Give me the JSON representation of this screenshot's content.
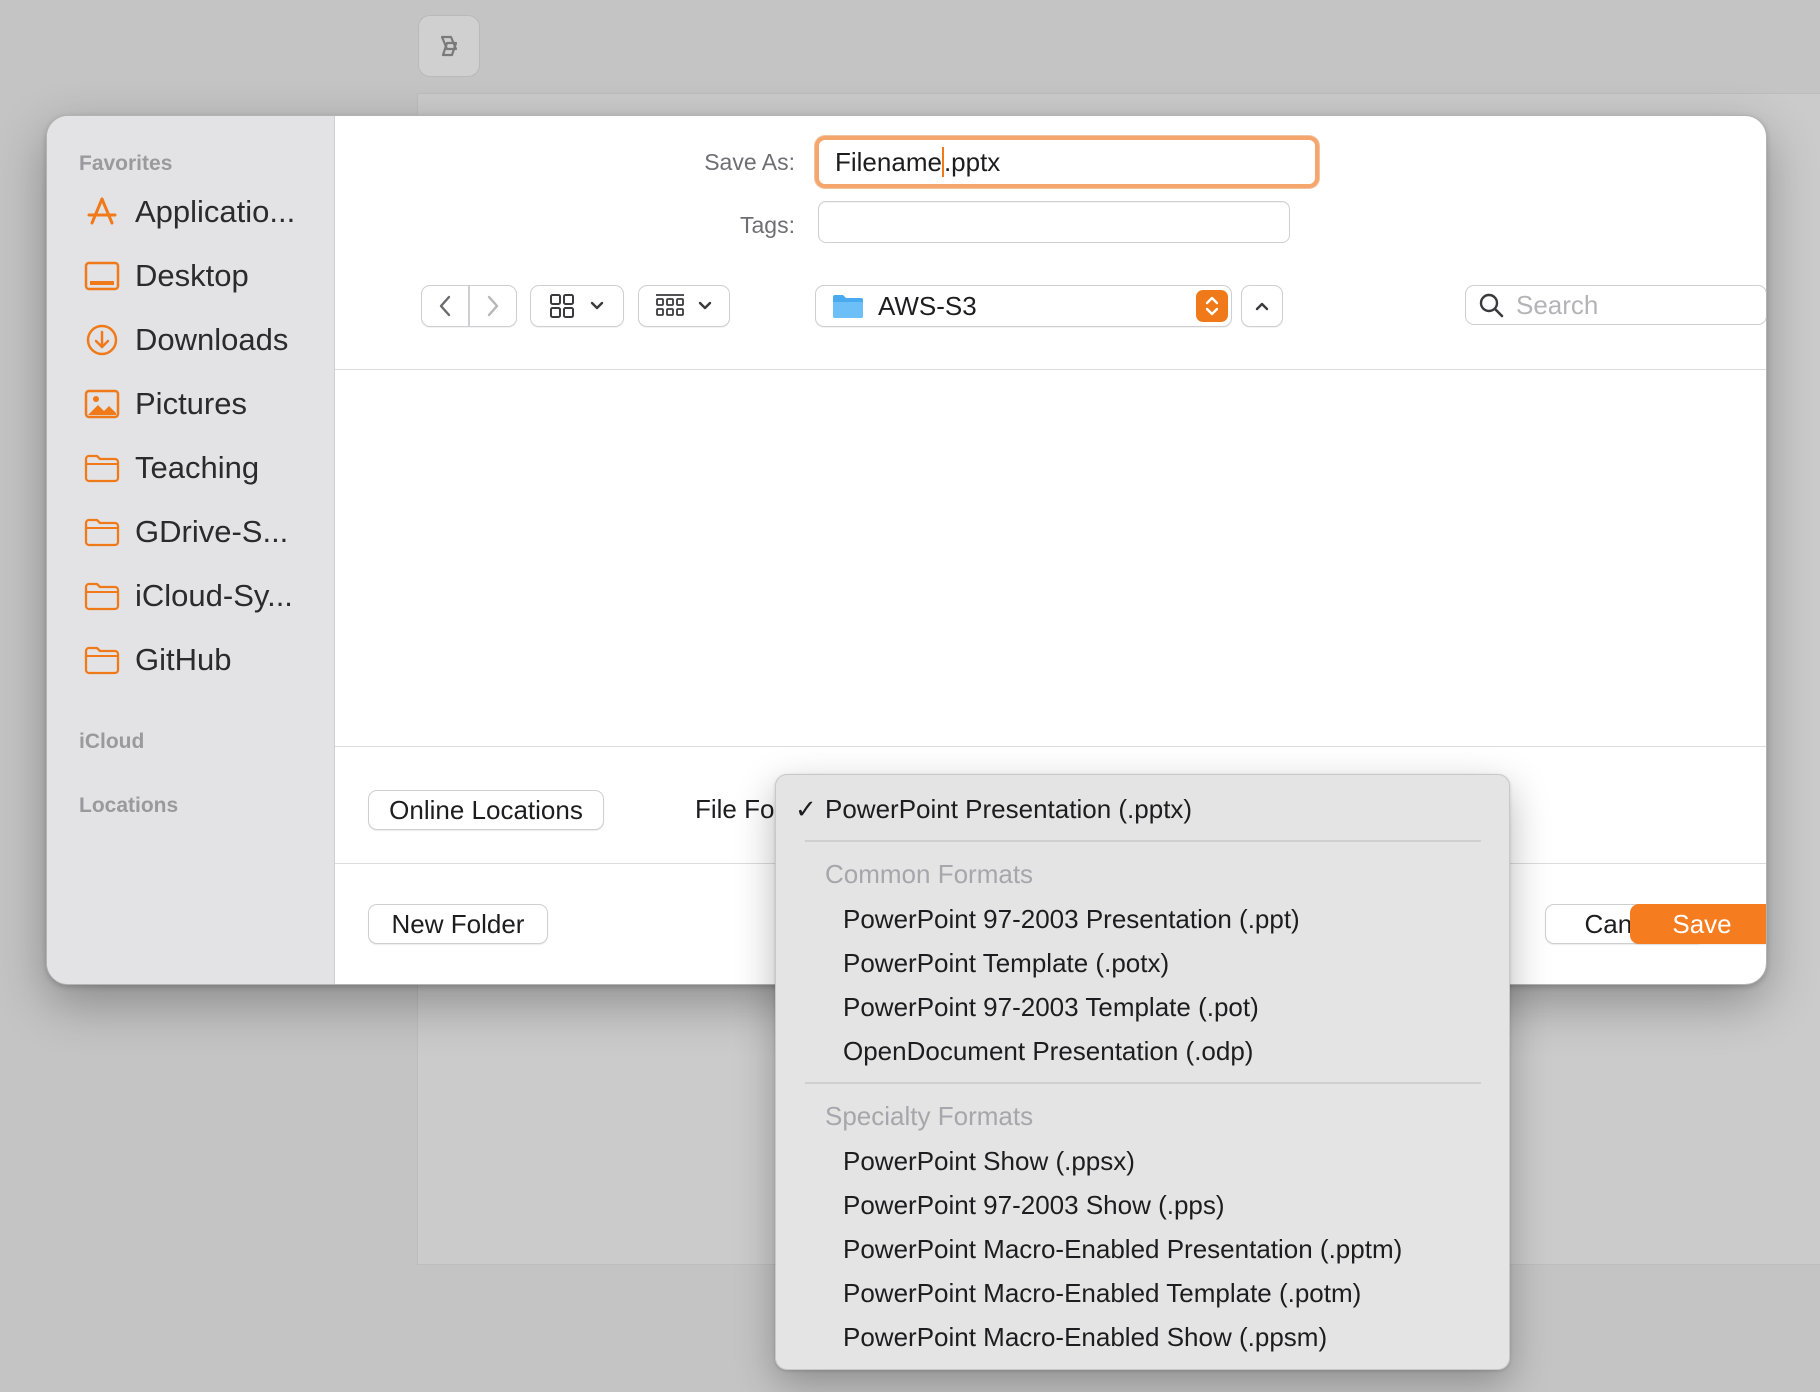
{
  "sidebar": {
    "sections": [
      {
        "title": "Favorites"
      },
      {
        "title": "iCloud"
      },
      {
        "title": "Locations"
      }
    ],
    "favorites": [
      {
        "label": "Applicatio...",
        "icon": "app-store-icon"
      },
      {
        "label": "Desktop",
        "icon": "desktop-icon"
      },
      {
        "label": "Downloads",
        "icon": "download-icon"
      },
      {
        "label": "Pictures",
        "icon": "pictures-icon"
      },
      {
        "label": "Teaching",
        "icon": "folder-icon"
      },
      {
        "label": "GDrive-S...",
        "icon": "folder-icon"
      },
      {
        "label": "iCloud-Sy...",
        "icon": "folder-icon"
      },
      {
        "label": "GitHub",
        "icon": "folder-icon"
      }
    ]
  },
  "form": {
    "save_as_label": "Save As:",
    "filename_stem": "Filename",
    "filename_ext": ".pptx",
    "tags_label": "Tags:",
    "tags_value": ""
  },
  "toolbar": {
    "location": "AWS-S3",
    "search_placeholder": "Search"
  },
  "footer": {
    "online_locations": "Online Locations",
    "file_format_label": "File Format",
    "new_folder": "New Folder",
    "cancel": "Cancel",
    "save": "Save"
  },
  "format_menu": {
    "selected": "PowerPoint Presentation (.pptx)",
    "checkmark": "✓",
    "groups": [
      {
        "title": "Common Formats",
        "items": [
          "PowerPoint 97-2003 Presentation (.ppt)",
          "PowerPoint Template (.potx)",
          "PowerPoint 97-2003 Template (.pot)",
          "OpenDocument Presentation (.odp)"
        ]
      },
      {
        "title": "Specialty Formats",
        "items": [
          "PowerPoint Show (.ppsx)",
          "PowerPoint 97-2003 Show (.pps)",
          "PowerPoint Macro-Enabled Presentation (.pptm)",
          "PowerPoint Macro-Enabled Template (.potm)",
          "PowerPoint Macro-Enabled Show (.ppsm)"
        ]
      }
    ]
  },
  "colors": {
    "accent": "#f57c1f",
    "sidebar_bg": "#e3e3e5",
    "backdrop": "#c4c4c4"
  }
}
